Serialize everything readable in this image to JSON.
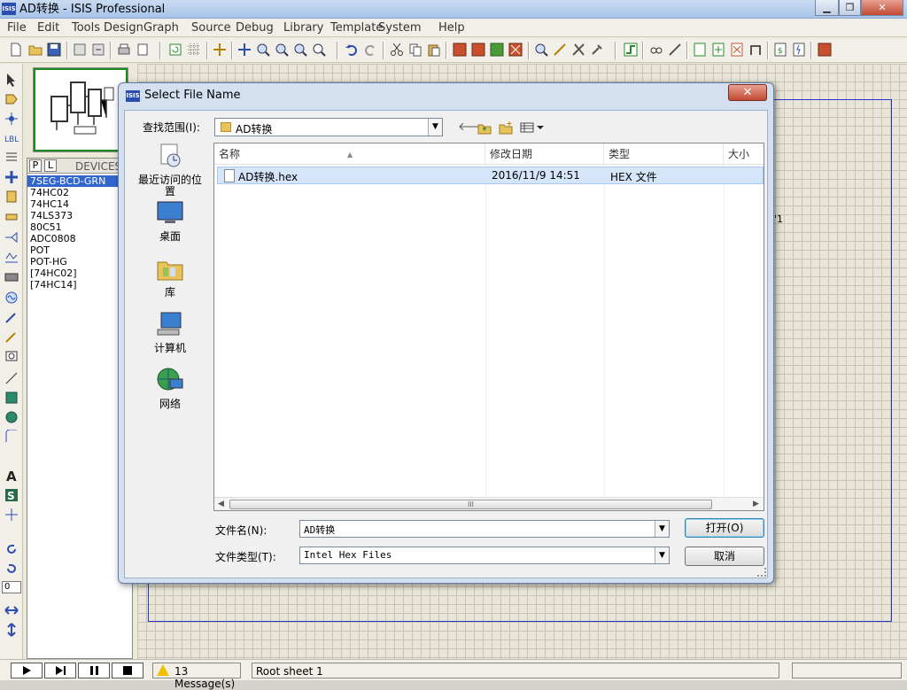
{
  "window": {
    "title": "AD转换 - ISIS Professional",
    "icon_text": "ISIS",
    "controls": [
      "minimize-icon",
      "maximize-icon",
      "close-icon"
    ]
  },
  "menu": [
    "File",
    "Edit",
    "Tools",
    "Design",
    "Graph",
    "Source",
    "Debug",
    "Library",
    "Template",
    "System",
    "Help"
  ],
  "devices": {
    "tabs": [
      "P",
      "L"
    ],
    "header": "DEVICES",
    "items": [
      "7SEG-BCD-GRN",
      "74HC02",
      "74HC14",
      "74LS373",
      "80C51",
      "ADC0808",
      "POT",
      "POT-HG",
      "[74HC02]",
      "[74HC14]"
    ],
    "selected": 0
  },
  "canvas": {
    "partial_label": "'1"
  },
  "rotation_value": "0",
  "statusbar": {
    "messages": "13 Message(s)",
    "sheet": "Root sheet 1",
    "coords": ""
  },
  "dialog": {
    "title": "Select File Name",
    "icon_text": "ISIS",
    "close_label": "✕",
    "look_in_label": "查找范围(I):",
    "look_in_value": "AD转换",
    "places": [
      "最近访问的位置",
      "桌面",
      "库",
      "计算机",
      "网络"
    ],
    "columns": [
      "名称",
      "修改日期",
      "类型",
      "大小"
    ],
    "files": [
      {
        "name": "AD转换.hex",
        "modified": "2016/11/9 14:51",
        "type": "HEX 文件",
        "size": ""
      }
    ],
    "filename_label": "文件名(N):",
    "filename_value": "AD转换",
    "filetype_label": "文件类型(T):",
    "filetype_value": "Intel Hex Files",
    "open_button": "打开(O)",
    "cancel_button": "取消",
    "scroll_grip": "III"
  },
  "colors": {
    "accent": "#3366cc",
    "sheet_border": "#2b34c8",
    "overview_border": "#1f8a1f",
    "selection": "#d5e6fb"
  }
}
